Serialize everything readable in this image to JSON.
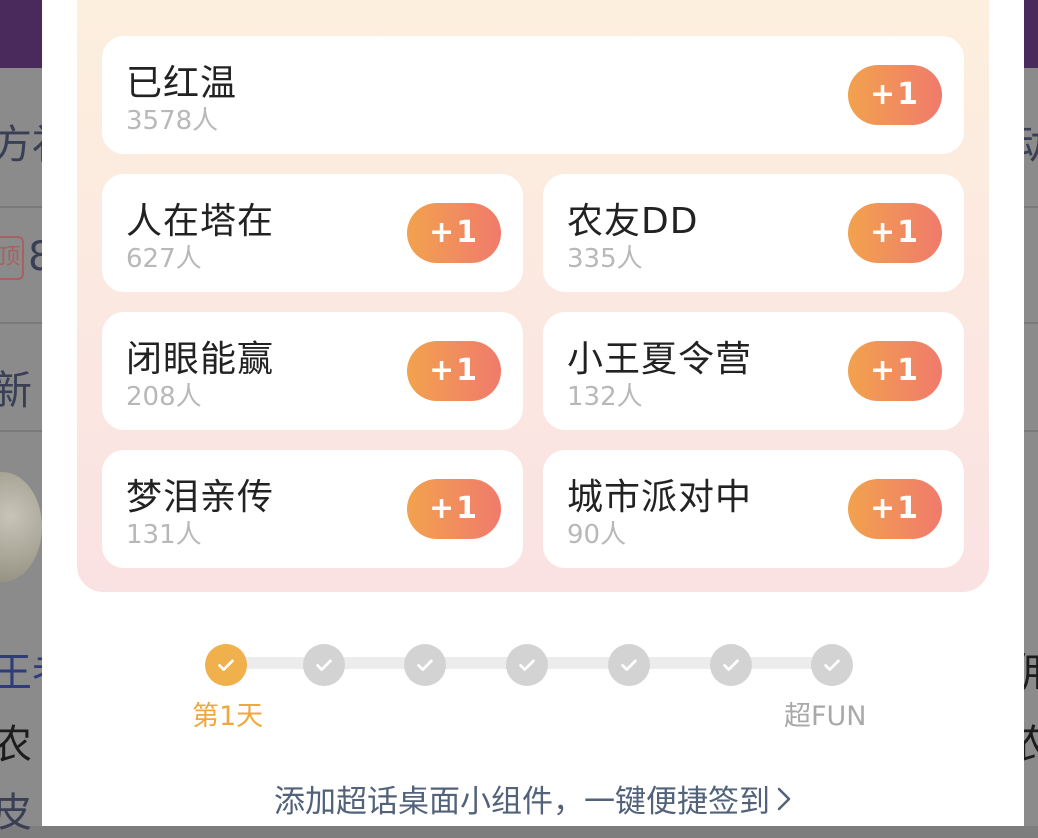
{
  "background": {
    "left_fragments": [
      "方补",
      "8",
      "新",
      "王者",
      "农",
      "皮"
    ],
    "right_fragments": [
      "动",
      "佣",
      "农"
    ],
    "badge": "顶"
  },
  "teams": [
    {
      "name": "已红温",
      "count": "3578人",
      "button": "+1"
    },
    {
      "name": "人在塔在",
      "count": "627人",
      "button": "+1"
    },
    {
      "name": "农友DD",
      "count": "335人",
      "button": "+1"
    },
    {
      "name": "闭眼能赢",
      "count": "208人",
      "button": "+1"
    },
    {
      "name": "小王夏令营",
      "count": "132人",
      "button": "+1"
    },
    {
      "name": "梦泪亲传",
      "count": "131人",
      "button": "+1"
    },
    {
      "name": "城市派对中",
      "count": "90人",
      "button": "+1"
    }
  ],
  "progress": {
    "start_label": "第1天",
    "end_label": "超FUN",
    "steps": 7,
    "current_step": 1
  },
  "footer_link": "添加超话桌面小组件，一键便捷签到",
  "colors": {
    "accent": "#f0b04c",
    "button_start": "#f2a24e",
    "button_end": "#f07a6c",
    "link": "#52627a"
  }
}
